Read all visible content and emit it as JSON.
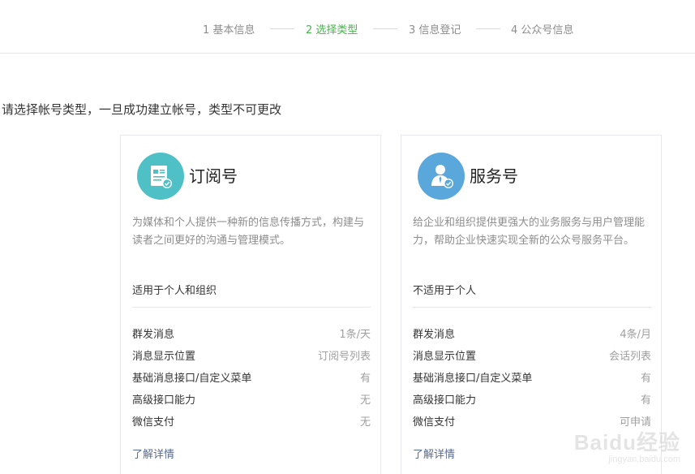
{
  "steps": [
    {
      "label": "1 基本信息",
      "active": false
    },
    {
      "label": "2 选择类型",
      "active": true
    },
    {
      "label": "3 信息登记",
      "active": false
    },
    {
      "label": "4 公众号信息",
      "active": false
    }
  ],
  "prompt": "请选择帐号类型，一旦成功建立帐号，类型不可更改",
  "cards": [
    {
      "title": "订阅号",
      "icon": "subscription-document-icon",
      "icon_color": "#4fc1c6",
      "description": "为媒体和个人提供一种新的信息传播方式，构建与读者之间更好的沟通与管理模式。",
      "fit": "适用于个人和组织",
      "features": [
        {
          "name": "群发消息",
          "value": "1条/天"
        },
        {
          "name": "消息显示位置",
          "value": "订阅号列表"
        },
        {
          "name": "基础消息接口/自定义菜单",
          "value": "有"
        },
        {
          "name": "高级接口能力",
          "value": "无"
        },
        {
          "name": "微信支付",
          "value": "无"
        }
      ],
      "more": "了解详情"
    },
    {
      "title": "服务号",
      "icon": "service-person-icon",
      "icon_color": "#5aa7dc",
      "description": "给企业和组织提供更强大的业务服务与用户管理能力，帮助企业快速实现全新的公众号服务平台。",
      "fit": "不适用于个人",
      "features": [
        {
          "name": "群发消息",
          "value": "4条/月"
        },
        {
          "name": "消息显示位置",
          "value": "会话列表"
        },
        {
          "name": "基础消息接口/自定义菜单",
          "value": "有"
        },
        {
          "name": "高级接口能力",
          "value": "有"
        },
        {
          "name": "微信支付",
          "value": "可申请"
        }
      ],
      "more": "了解详情"
    }
  ],
  "watermark": {
    "brand": "Baidu经验",
    "url": "jingyan.baidu.com"
  }
}
